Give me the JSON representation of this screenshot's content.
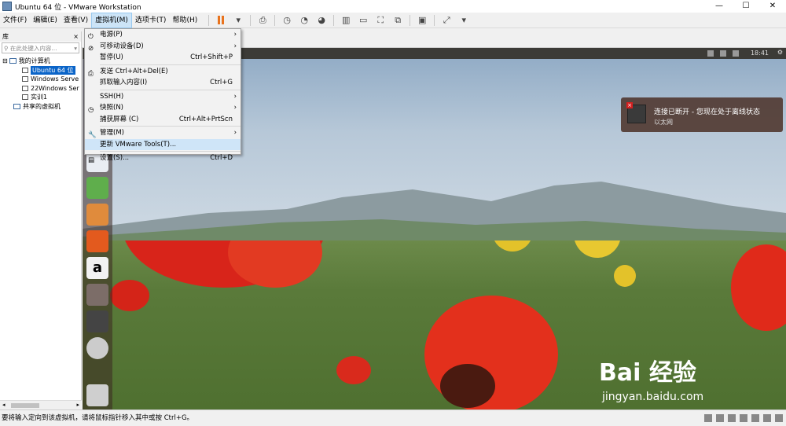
{
  "window": {
    "title": "Ubuntu 64 位 - VMware Workstation"
  },
  "winctl": {
    "min": "—",
    "max": "☐",
    "close": "✕"
  },
  "menubar": {
    "items": [
      "文件(F)",
      "编辑(E)",
      "查看(V)",
      "虚拟机(M)",
      "选项卡(T)",
      "帮助(H)"
    ]
  },
  "library": {
    "header": "库",
    "close": "×",
    "search_placeholder": "在此处键入内容...",
    "tree": {
      "root": "我的计算机",
      "children": [
        "Ubuntu 64 位",
        "Windows Serve",
        "22Windows Ser",
        "实训1"
      ],
      "shared": "共享的虚拟机"
    }
  },
  "vm_menu": {
    "items": [
      {
        "label": "电源(P)",
        "shortcut": "",
        "submenu": true
      },
      {
        "label": "可移动设备(D)",
        "shortcut": "",
        "submenu": true
      },
      {
        "label": "暂停(U)",
        "shortcut": "Ctrl+Shift+P",
        "submenu": false
      },
      {
        "label": "发送 Ctrl+Alt+Del(E)",
        "shortcut": "",
        "submenu": false
      },
      {
        "label": "抓取输入内容(I)",
        "shortcut": "Ctrl+G",
        "submenu": false
      },
      {
        "label": "SSH(H)",
        "shortcut": "",
        "submenu": true
      },
      {
        "label": "快照(N)",
        "shortcut": "",
        "submenu": true
      },
      {
        "label": "捕获屏幕 (C)",
        "shortcut": "Ctrl+Alt+PrtScn",
        "submenu": false
      },
      {
        "label": "管理(M)",
        "shortcut": "",
        "submenu": true
      },
      {
        "label": "更新 VMware Tools(T)...",
        "shortcut": "",
        "submenu": false
      },
      {
        "label": "设置(S)...",
        "shortcut": "Ctrl+D",
        "submenu": false
      }
    ]
  },
  "guest": {
    "clock": "18:41",
    "notification": {
      "title": "连接已断开 - 您现在处于离线状态",
      "subtitle": "以太网"
    }
  },
  "statusbar": {
    "text": "要将输入定向到该虚拟机，请将鼠标指针移入其中或按 Ctrl+G。"
  },
  "watermark": {
    "brand": "Bai  经验",
    "url": "jingyan.baidu.com"
  },
  "colors": {
    "selection": "#0a64c8",
    "menu_highlight": "#cfe5f8",
    "pause": "#e8731e"
  }
}
